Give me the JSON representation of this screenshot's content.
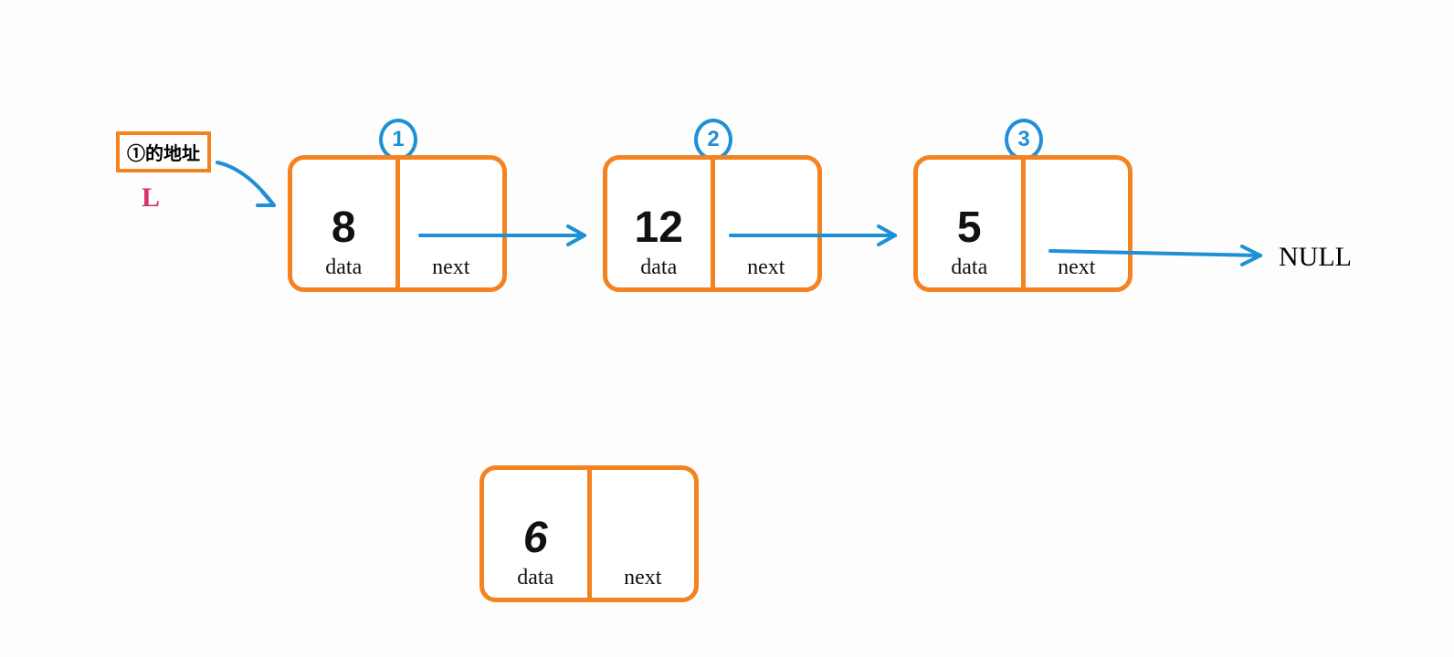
{
  "diagram": {
    "type": "singly-linked-list",
    "head": {
      "box_text": "①的地址",
      "label": "L"
    },
    "nodes": [
      {
        "index": 1,
        "badge": "1",
        "data": "8",
        "data_label": "data",
        "next_label": "next"
      },
      {
        "index": 2,
        "badge": "2",
        "data": "12",
        "data_label": "data",
        "next_label": "next"
      },
      {
        "index": 3,
        "badge": "3",
        "data": "5",
        "data_label": "data",
        "next_label": "next"
      }
    ],
    "terminator": "NULL",
    "detached_node": {
      "data": "6",
      "data_label": "data",
      "next_label": "next"
    }
  }
}
